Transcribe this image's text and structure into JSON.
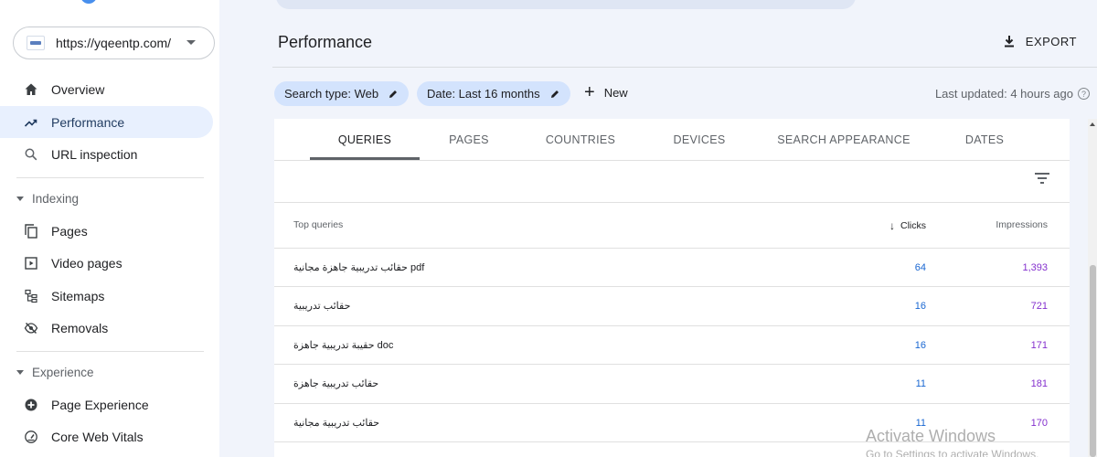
{
  "property": {
    "url": "https://yqeentp.com/"
  },
  "sidebar": {
    "items": [
      {
        "label": "Overview",
        "icon": "home-icon"
      },
      {
        "label": "Performance",
        "icon": "trending-up-icon",
        "active": true
      },
      {
        "label": "URL inspection",
        "icon": "search-icon"
      }
    ],
    "sections": [
      {
        "title": "Indexing",
        "items": [
          {
            "label": "Pages",
            "icon": "pages-icon"
          },
          {
            "label": "Video pages",
            "icon": "video-pages-icon"
          },
          {
            "label": "Sitemaps",
            "icon": "sitemap-icon"
          },
          {
            "label": "Removals",
            "icon": "removals-icon"
          }
        ]
      },
      {
        "title": "Experience",
        "items": [
          {
            "label": "Page Experience",
            "icon": "page-experience-icon"
          },
          {
            "label": "Core Web Vitals",
            "icon": "gauge-icon"
          }
        ]
      }
    ]
  },
  "header": {
    "title": "Performance",
    "export_label": "EXPORT"
  },
  "filters": {
    "chips": [
      "Search type: Web",
      "Date: Last 16 months"
    ],
    "new_label": "New",
    "last_updated": "Last updated: 4 hours ago"
  },
  "tabs": [
    "QUERIES",
    "PAGES",
    "COUNTRIES",
    "DEVICES",
    "SEARCH APPEARANCE",
    "DATES"
  ],
  "table": {
    "headers": {
      "query": "Top queries",
      "clicks": "Clicks",
      "impressions": "Impressions"
    },
    "rows": [
      {
        "query": "حقائب تدريبية جاهزة مجانية pdf",
        "clicks": "64",
        "impressions": "1,393"
      },
      {
        "query": "حقائب تدريبية",
        "clicks": "16",
        "impressions": "721"
      },
      {
        "query": "حقيبة تدريبية جاهزة doc",
        "clicks": "16",
        "impressions": "171"
      },
      {
        "query": "حقائب تدريبية جاهزة",
        "clicks": "11",
        "impressions": "181"
      },
      {
        "query": "حقائب تدريبية مجانية",
        "clicks": "11",
        "impressions": "170"
      }
    ]
  },
  "colors": {
    "accent": "#1a73e8",
    "active_nav": "#e8f0fe",
    "clicks": "#1967d2",
    "impressions": "#8430ce",
    "chip": "#d3e3fd"
  },
  "watermark": {
    "line1": "Activate Windows",
    "line2": "Go to Settings to activate Windows."
  }
}
